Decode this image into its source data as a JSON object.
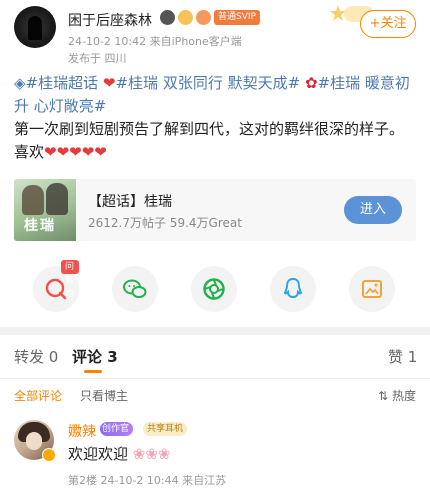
{
  "post": {
    "author": {
      "name": "困于后座森林",
      "vip_label": "普通SVIP"
    },
    "meta_line1": "24-10-2 10:42  来自iPhone客户端",
    "meta_line2": "发布于 四川",
    "follow_label": "+关注",
    "tags": [
      "#桂瑞超话",
      "#桂瑞 双张同行 默契天成#",
      "#桂瑞 暖意初升 心灯敞亮#"
    ],
    "body_text": "第一次刷到短剧预告了解到四代，这对的羁绊很深的样子。喜欢",
    "hearts": 5
  },
  "topic_card": {
    "image_text": "桂瑞",
    "title": "【超话】桂瑞",
    "stats": "2612.7万帖子 59.4万Great",
    "button_label": "进入"
  },
  "share": {
    "ask_label": "问智搜",
    "items": [
      "ask-ai",
      "wechat",
      "moments",
      "qq",
      "save-image"
    ]
  },
  "tabs": {
    "repost_label": "转发 0",
    "comment_label": "评论 3",
    "like_label": "赞 1"
  },
  "filter": {
    "all_label": "全部评论",
    "author_only_label": "只看博主",
    "sort_label": "热度"
  },
  "comment": {
    "name": "嫐辣",
    "badge1": "创作官",
    "badge2": "共享耳机",
    "text": "欢迎欢迎",
    "meta": "第2楼  24-10-2 10:44  来自江苏"
  },
  "colors": {
    "accent": "#ff8200",
    "link": "#4d7ab0",
    "heart": "#e83a3a",
    "enter_button": "#5b93d6"
  }
}
